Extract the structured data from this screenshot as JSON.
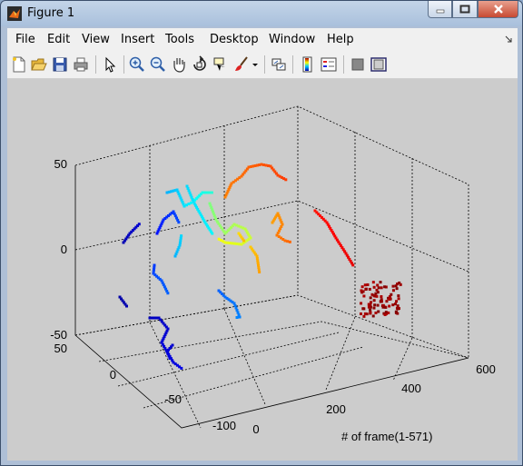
{
  "window": {
    "title": "Figure 1"
  },
  "menu": [
    "File",
    "Edit",
    "View",
    "Insert",
    "Tools",
    "Desktop",
    "Window",
    "Help"
  ],
  "toolbar_icons": [
    "new-figure-icon",
    "open-file-icon",
    "save-icon",
    "print-icon",
    "select-arrow-icon",
    "zoom-in-icon",
    "zoom-out-icon",
    "pan-icon",
    "rotate-3d-icon",
    "data-cursor-icon",
    "brush-icon",
    "brush-dropdown-icon",
    "link-plot-icon",
    "colorbar-icon",
    "legend-icon",
    "hide-plot-tools-icon",
    "show-plot-tools-icon"
  ],
  "chart_data": {
    "type": "scatter",
    "title": "",
    "xlabel": "# of frame(1-571)",
    "ylabel": "",
    "zlabel": "",
    "xlim": [
      0,
      600
    ],
    "ylim": [
      -100,
      50
    ],
    "zlim": [
      -50,
      50
    ],
    "xticks": [
      "0",
      "200",
      "400",
      "600"
    ],
    "yticks": [
      "-100",
      "-50",
      "0",
      "50"
    ],
    "zticks": [
      "-50",
      "0",
      "50"
    ],
    "colormap": "jet",
    "grid": true,
    "box": true
  }
}
